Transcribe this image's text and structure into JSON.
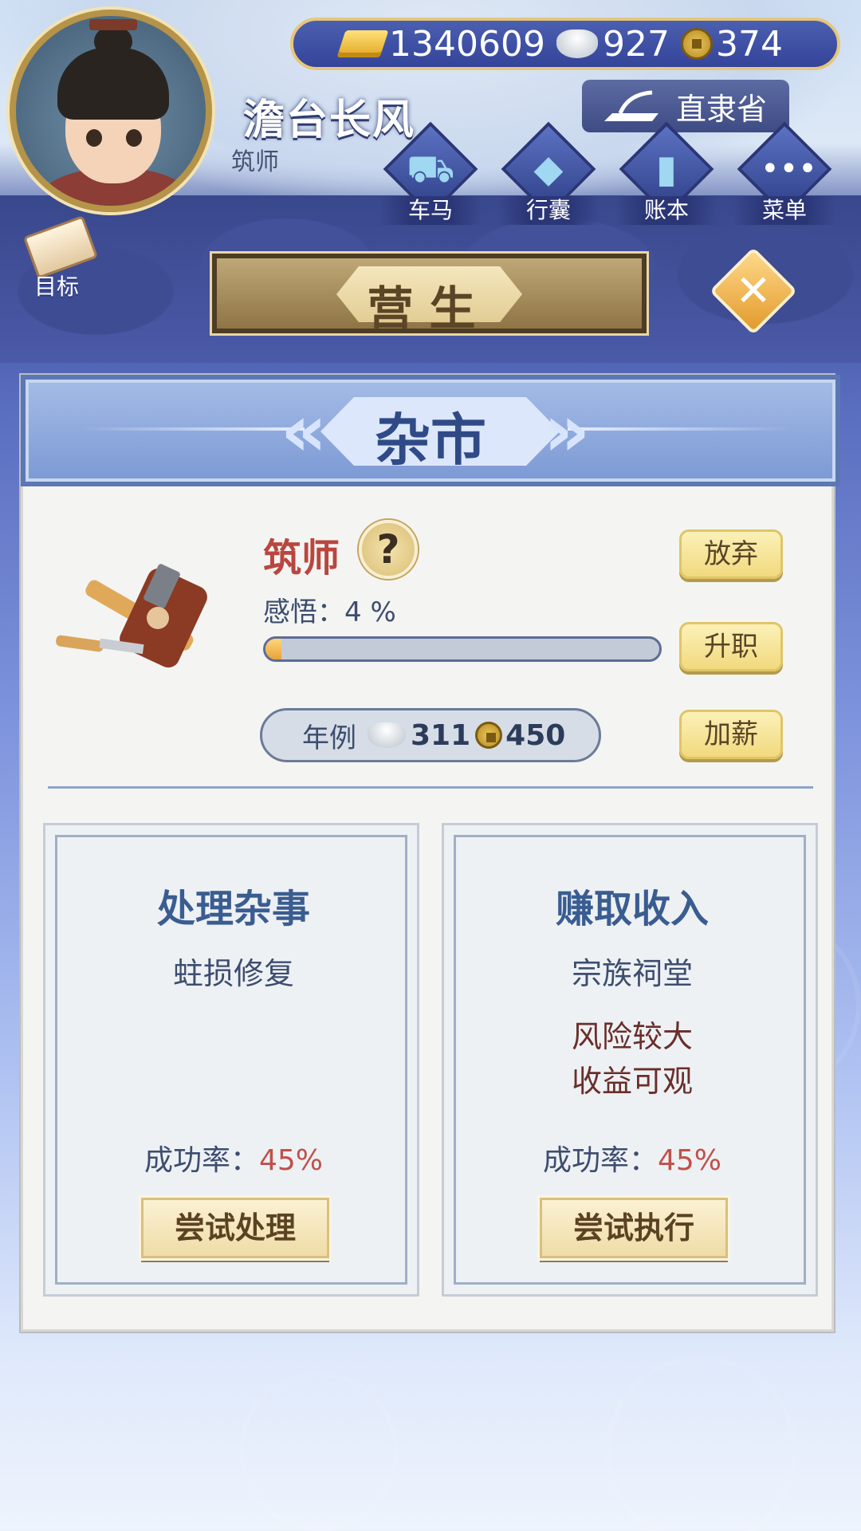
{
  "player": {
    "name": "澹台长风",
    "title": "筑师"
  },
  "currency": {
    "gold": "1340609",
    "silver": "927",
    "coin": "374"
  },
  "province": "直隶省",
  "nav": [
    {
      "label": "车马",
      "icon": "carriage-icon"
    },
    {
      "label": "行囊",
      "icon": "bag-icon"
    },
    {
      "label": "账本",
      "icon": "ledger-icon"
    },
    {
      "label": "菜单",
      "icon": "menu-icon"
    }
  ],
  "goal_label": "目标",
  "screen_title": "营生",
  "market_title": "杂市",
  "job": {
    "name": "筑师",
    "insight_label": "感悟：",
    "insight_value": "4 %",
    "progress_fraction": 0.04,
    "salary_label": "年例",
    "salary_silver": "311",
    "salary_coin": "450",
    "buttons": {
      "abandon": "放弃",
      "promote": "升职",
      "raise": "加薪"
    }
  },
  "cards": [
    {
      "title": "处理杂事",
      "subtitle": "蛀损修复",
      "note_lines": [],
      "rate_label": "成功率：",
      "rate_value": "45%",
      "action": "尝试处理"
    },
    {
      "title": "赚取收入",
      "subtitle": "宗族祠堂",
      "note_lines": [
        "风险较大",
        "收益可观"
      ],
      "rate_label": "成功率：",
      "rate_value": "45%",
      "action": "尝试执行"
    }
  ],
  "colors": {
    "accent_gold": "#e6c77a",
    "panel_blue": "#7c99d4",
    "rate_red": "#c0504a",
    "title_red": "#b9473f"
  }
}
